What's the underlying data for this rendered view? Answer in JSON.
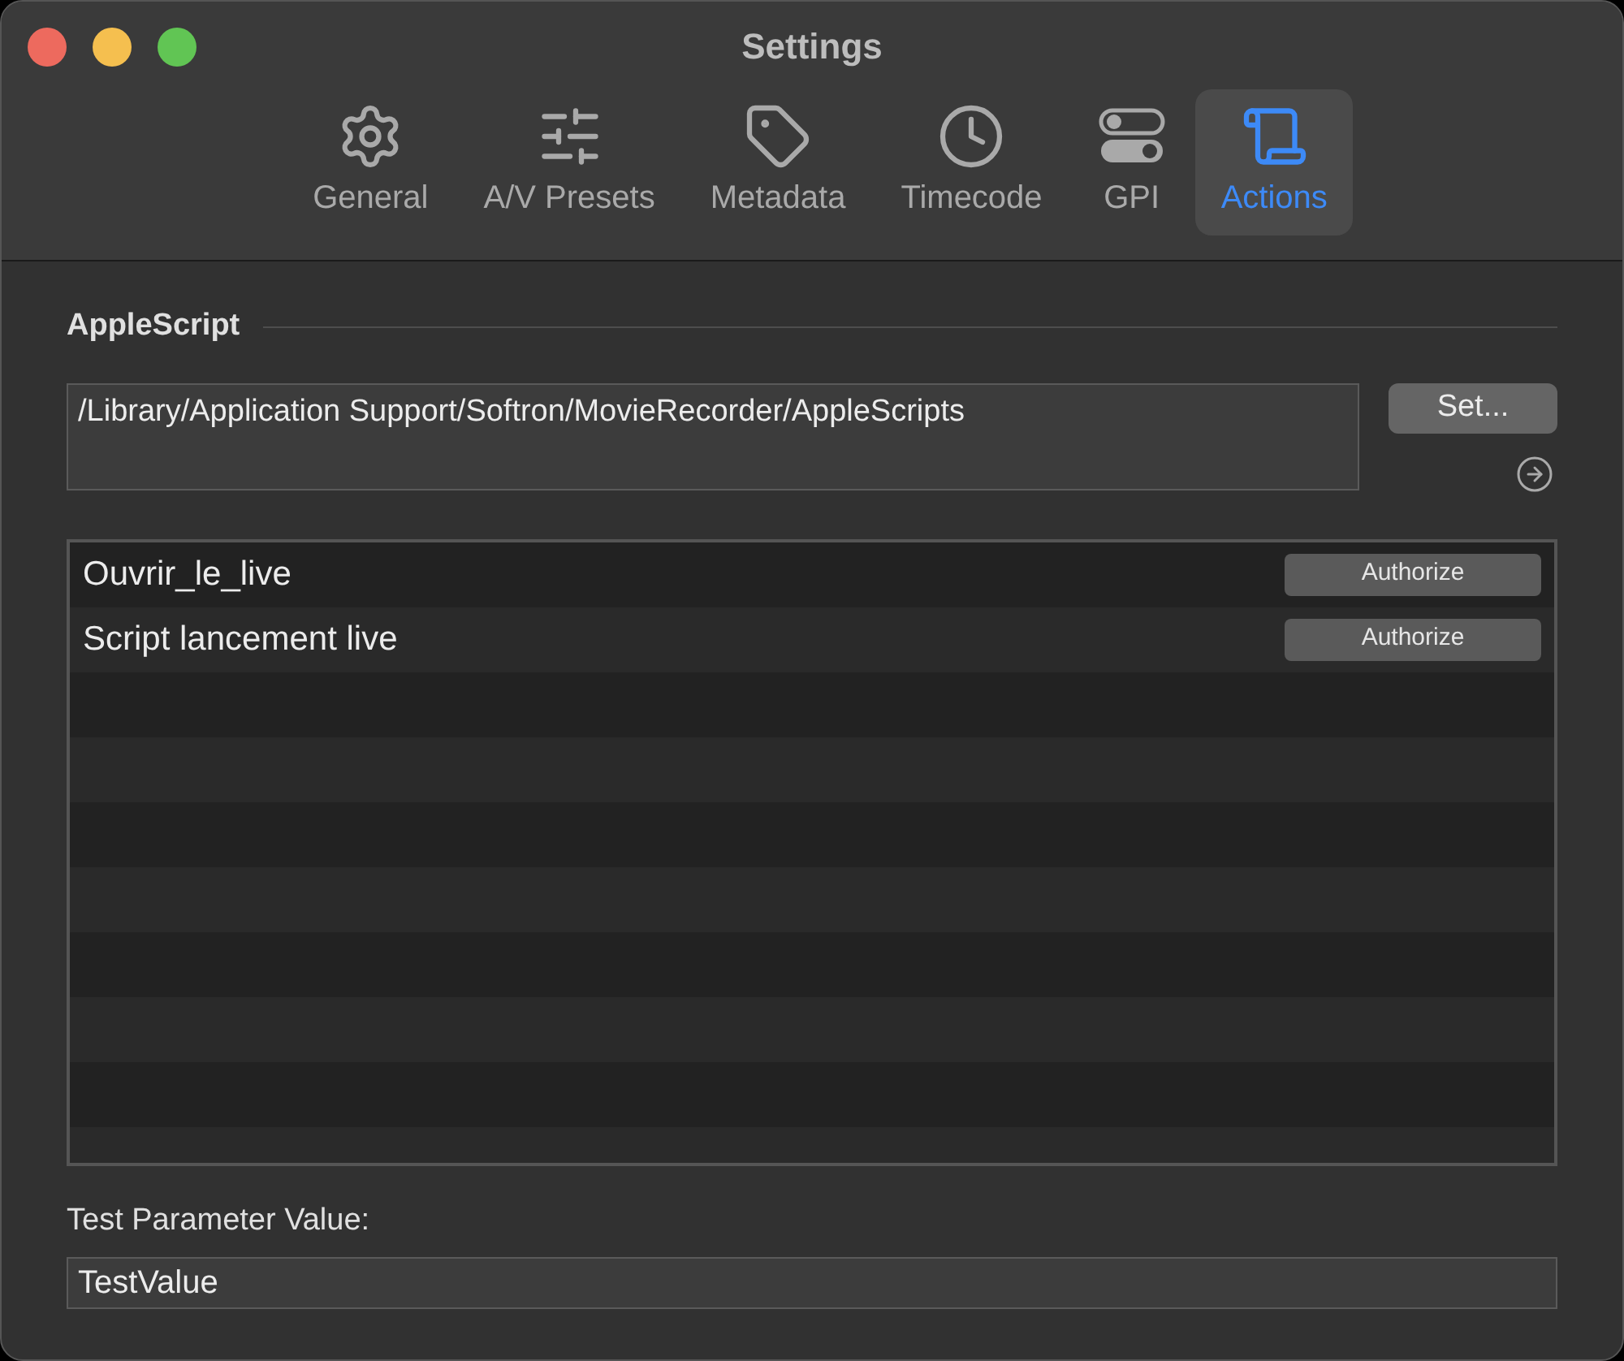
{
  "window": {
    "title": "Settings"
  },
  "tabs": [
    {
      "label": "General",
      "kind": "gear",
      "selected": false
    },
    {
      "label": "A/V Presets",
      "kind": "sliders",
      "selected": false
    },
    {
      "label": "Metadata",
      "kind": "tag",
      "selected": false
    },
    {
      "label": "Timecode",
      "kind": "clock",
      "selected": false
    },
    {
      "label": "GPI",
      "kind": "toggles",
      "selected": false
    },
    {
      "label": "Actions",
      "kind": "script",
      "selected": true
    }
  ],
  "applescript": {
    "heading": "AppleScript",
    "path": "/Library/Application Support/Softron/MovieRecorder/AppleScripts",
    "set_button": "Set..."
  },
  "scripts": [
    {
      "name": "Ouvrir_le_live",
      "button": "Authorize"
    },
    {
      "name": "Script lancement live",
      "button": "Authorize"
    }
  ],
  "test_parameter": {
    "label": "Test Parameter Value:",
    "value": "TestValue"
  }
}
